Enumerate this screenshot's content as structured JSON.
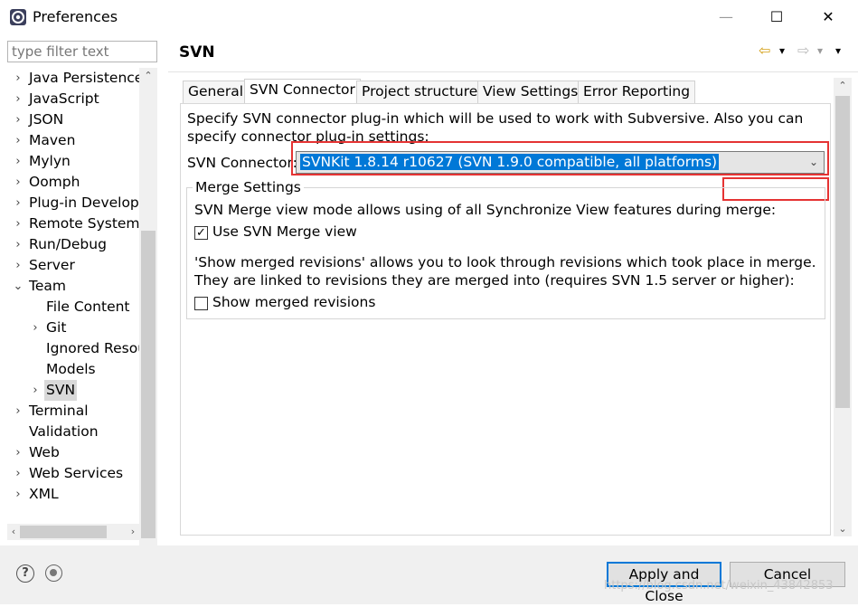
{
  "window": {
    "title": "Preferences",
    "minimize": "—",
    "maximize": "☐",
    "close": "✕"
  },
  "filter": {
    "placeholder": "type filter text"
  },
  "tree": {
    "items": [
      {
        "label": "Java Persistence",
        "chevron": "›"
      },
      {
        "label": "JavaScript",
        "chevron": "›"
      },
      {
        "label": "JSON",
        "chevron": "›"
      },
      {
        "label": "Maven",
        "chevron": "›"
      },
      {
        "label": "Mylyn",
        "chevron": "›"
      },
      {
        "label": "Oomph",
        "chevron": "›"
      },
      {
        "label": "Plug-in Developr",
        "chevron": "›"
      },
      {
        "label": "Remote Systems",
        "chevron": "›"
      },
      {
        "label": "Run/Debug",
        "chevron": "›"
      },
      {
        "label": "Server",
        "chevron": "›"
      },
      {
        "label": "Team",
        "chevron": "⌄"
      },
      {
        "label": "File Content",
        "chevron": ""
      },
      {
        "label": "Git",
        "chevron": "›"
      },
      {
        "label": "Ignored Resou",
        "chevron": ""
      },
      {
        "label": "Models",
        "chevron": ""
      },
      {
        "label": "SVN",
        "chevron": "›"
      },
      {
        "label": "Terminal",
        "chevron": "›"
      },
      {
        "label": "Validation",
        "chevron": ""
      },
      {
        "label": "Web",
        "chevron": "›"
      },
      {
        "label": "Web Services",
        "chevron": "›"
      },
      {
        "label": "XML",
        "chevron": "›"
      }
    ],
    "selected": "SVN"
  },
  "page": {
    "title": "SVN",
    "nav": {
      "back": "⇦",
      "back_menu": "▾",
      "forward": "⇨",
      "forward_menu": "▾",
      "view_menu": "▾"
    }
  },
  "tabs": [
    {
      "label": "General"
    },
    {
      "label": "SVN Connector"
    },
    {
      "label": "Project structure"
    },
    {
      "label": "View Settings"
    },
    {
      "label": "Error Reporting"
    }
  ],
  "connector": {
    "description": "Specify SVN connector plug-in which will be used to work with Subversive. Also you can specify connector plug-in settings:",
    "label": "SVN Connector:",
    "selected": "SVNKit 1.8.14 r10627 (SVN 1.9.0 compatible, all platforms)"
  },
  "merge": {
    "group_title": "Merge Settings",
    "mode_text": "SVN Merge view mode allows using of all Synchronize View features during merge:",
    "use_svn_merge_label": "Use SVN Merge view",
    "use_svn_merge_checked": true,
    "show_merged_text": "'Show merged revisions' allows you to look through revisions which took place in merge. They are linked to revisions they are merged into (requires SVN 1.5 server or higher):",
    "show_merged_label": "Show merged revisions",
    "show_merged_checked": false
  },
  "buttons": {
    "help": "?",
    "apply_close": "Apply and Close",
    "cancel": "Cancel"
  },
  "watermark": "https://blog.csdn.net/weixin_43842853"
}
